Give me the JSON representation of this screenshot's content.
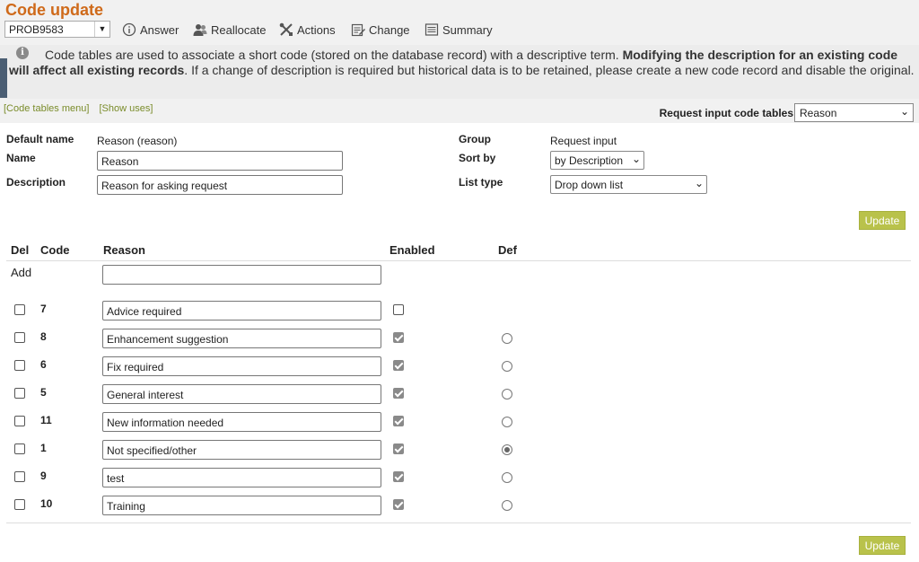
{
  "title": "Code update",
  "record_select": "PROB9583",
  "toolbar": [
    {
      "label": "Answer",
      "icon": "info-circle-icon"
    },
    {
      "label": "Reallocate",
      "icon": "users-icon"
    },
    {
      "label": "Actions",
      "icon": "tools-icon"
    },
    {
      "label": "Change",
      "icon": "edit-icon"
    },
    {
      "label": "Summary",
      "icon": "list-icon"
    }
  ],
  "notice": {
    "text1": "Code tables are used to associate a short code (stored on the database record) with a descriptive term. ",
    "bold": "Modifying the description for an existing code will affect all existing records",
    "text2": ". If a change of description is required but historical data is to be retained, please create a new code record and disable the original."
  },
  "links": {
    "menu": "[Code tables menu]",
    "uses": "[Show uses]"
  },
  "request_input": {
    "label": "Request input code tables",
    "value": "Reason"
  },
  "form": {
    "default_name_label": "Default name",
    "default_name_value": "Reason (reason)",
    "name_label": "Name",
    "name_value": "Reason",
    "description_label": "Description",
    "description_value": "Reason for asking request",
    "group_label": "Group",
    "group_value": "Request input",
    "sort_label": "Sort by",
    "sort_value": "by Description",
    "list_type_label": "List type",
    "list_type_value": "Drop down list",
    "update_label": "Update"
  },
  "table": {
    "headers": {
      "del": "Del",
      "code": "Code",
      "reason": "Reason",
      "enabled": "Enabled",
      "def": "Def"
    },
    "add_label": "Add",
    "add_value": "",
    "rows": [
      {
        "code": "7",
        "reason": "Advice required",
        "enabled": false,
        "def": null
      },
      {
        "code": "8",
        "reason": "Enhancement suggestion",
        "enabled": true,
        "def": false
      },
      {
        "code": "6",
        "reason": "Fix required",
        "enabled": true,
        "def": false
      },
      {
        "code": "5",
        "reason": "General interest",
        "enabled": true,
        "def": false
      },
      {
        "code": "11",
        "reason": "New information needed",
        "enabled": true,
        "def": false
      },
      {
        "code": "1",
        "reason": "Not specified/other",
        "enabled": true,
        "def": true
      },
      {
        "code": "9",
        "reason": "test",
        "enabled": true,
        "def": false
      },
      {
        "code": "10",
        "reason": "Training",
        "enabled": true,
        "def": false
      }
    ],
    "update_label": "Update"
  },
  "colors": {
    "title": "#cf6a1a",
    "button": "#b9c24b",
    "links": "#7a8c2a",
    "notice_bar": "#4b5e73"
  }
}
